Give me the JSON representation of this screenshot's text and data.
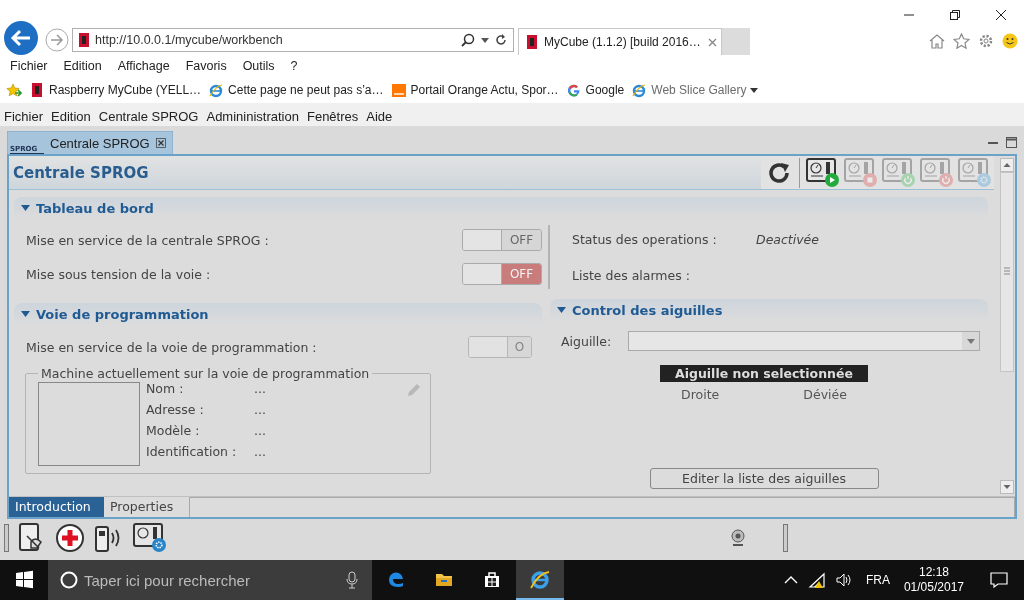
{
  "browser": {
    "address": "http://10.0.0.1/mycube/workbench",
    "tabs": [
      {
        "title": "MyCube (1.1.2) [build 2016…",
        "selected": true
      }
    ],
    "menu": [
      "Fichier",
      "Edition",
      "Affichage",
      "Favoris",
      "Outils",
      "?"
    ],
    "favorites": [
      {
        "label": "Raspberry MyCube (YELL…",
        "kind": "raspberry",
        "dimmed": false,
        "menu": false
      },
      {
        "label": "Cette page ne peut pas s’a…",
        "kind": "ie",
        "dimmed": false,
        "menu": false
      },
      {
        "label": "Portail Orange  Actu, Spor…",
        "kind": "orange",
        "dimmed": false,
        "menu": false
      },
      {
        "label": "Google",
        "kind": "google",
        "dimmed": false,
        "menu": false
      },
      {
        "label": "Web Slice Gallery",
        "kind": "ie",
        "dimmed": true,
        "menu": true
      }
    ]
  },
  "app_menu": [
    "Fichier",
    "Edition",
    "Centrale SPROG",
    "Admininistration",
    "Fenêtres",
    "Aide"
  ],
  "view_tab": {
    "label": "Centrale SPROG",
    "icon_text": "SPROG"
  },
  "panel": {
    "title": "Centrale SPROG",
    "toolbar": [
      {
        "kind": "refresh",
        "disabled": false
      },
      {
        "kind": "play",
        "disabled": false
      },
      {
        "kind": "stop",
        "disabled": true
      },
      {
        "kind": "power-on",
        "disabled": true
      },
      {
        "kind": "power-off",
        "disabled": true
      },
      {
        "kind": "settings",
        "disabled": true
      }
    ]
  },
  "dashboard": {
    "title": "Tableau de bord",
    "expanded": true,
    "rows": [
      {
        "label": "Mise en service de la centrale SPROG :",
        "on": false,
        "alert": false,
        "text": "OFF"
      },
      {
        "label": "Mise sous tension de la voie :",
        "on": false,
        "alert": true,
        "text": "OFF"
      }
    ],
    "status": [
      {
        "label": "Status des operations :",
        "value": "Deactivée"
      },
      {
        "label": "Liste des alarmes :"
      }
    ]
  },
  "programming": {
    "title": "Voie de programmation",
    "expanded": true,
    "row": {
      "label": "Mise en service de la voie de programmation :",
      "on": false,
      "disabled": true,
      "text": "O"
    },
    "machine": {
      "legend": "Machine actuellement sur la voie de programmation",
      "fields": [
        {
          "label": "Nom :",
          "value": "..."
        },
        {
          "label": "Adresse :",
          "value": "..."
        },
        {
          "label": "Modèle :",
          "value": "..."
        },
        {
          "label": "Identification :",
          "value": "..."
        }
      ]
    }
  },
  "turnouts": {
    "title": "Control des aiguilles",
    "expanded": true,
    "select_label": "Aiguille:",
    "status": "Aiguille non selectionnée",
    "positions": [
      "Droite",
      "Déviée"
    ],
    "button": "Editer la liste des aiguilles"
  },
  "bottom_tabs": [
    {
      "label": "Introduction",
      "selected": true
    },
    {
      "label": "Properties",
      "selected": false
    }
  ],
  "taskbar": {
    "search_placeholder": "Taper ici pour rechercher",
    "apps": [
      {
        "kind": "edge",
        "selected": false
      },
      {
        "kind": "explorer",
        "selected": false
      },
      {
        "kind": "store",
        "selected": false
      },
      {
        "kind": "ie",
        "selected": true
      }
    ],
    "language": "FRA",
    "time": "12:18",
    "date": "01/05/2017"
  }
}
